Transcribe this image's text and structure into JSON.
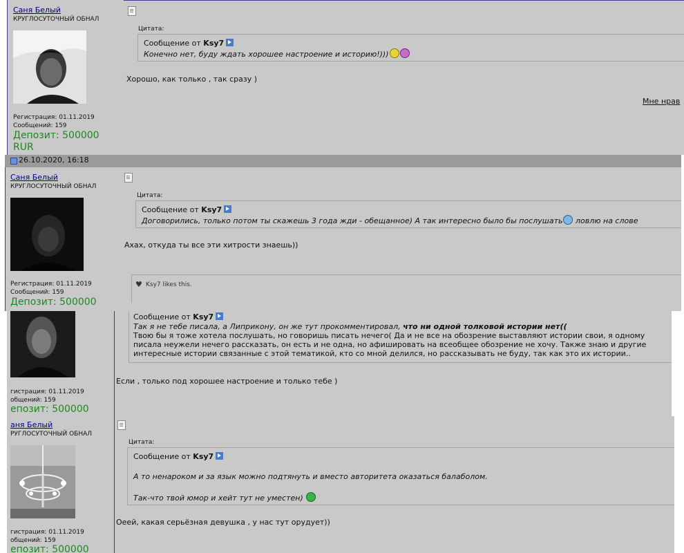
{
  "segments": [
    {
      "user": {
        "name": "Саня Белый",
        "title": "КРУГЛОСУТОЧНЫЙ ОБНАЛ",
        "reg": "Регистрация: 01.11.2019",
        "posts": "Сообщений: 159",
        "deposit_l1": "Депозит: 500000",
        "deposit_l2": "RUR"
      },
      "quote_label": "Цитата:",
      "quote_prefix": "Сообщение от",
      "quote_author": "Ksy7",
      "quote_text": "Конечно нет, буду ждать хорошее настроение и историю!)))",
      "body": "Хорошо, как только , так сразу )",
      "like_link": "Мне нрав"
    },
    {
      "datebar": "26.10.2020, 16:18",
      "user": {
        "name": "Саня Белый",
        "title": "КРУГЛОСУТОЧНЫЙ ОБНАЛ",
        "reg": "Регистрация: 01.11.2019",
        "posts": "Сообщений: 159",
        "deposit_l1": "Депозит: 500000"
      },
      "quote_label": "Цитата:",
      "quote_prefix": "Сообщение от",
      "quote_author": "Ksy7",
      "quote_text": "Договорились, только потом ты скажешь 3 года жди - обещанное) А так интересно было бы послушать",
      "quote_tail": "ловлю на слове",
      "body": "Ахах, откуда ты все эти хитрости знаешь))",
      "likes_user": "Ksy7",
      "likes_suffix": "likes this."
    },
    {
      "user": {
        "reg": "гистрация: 01.11.2019",
        "posts": "общений: 159",
        "deposit_l1": "епозит: 500000"
      },
      "quote_prefix": "Сообщение от",
      "quote_author": "Ksy7",
      "quote_l1": "Так я не тебе писала, а Липрикону, он же тут прокомментировал,",
      "quote_l1_bold": "что ни одной толковой истории нет((",
      "quote_l2": "Твою бы я тоже хотела послушать, но говоришь писать нечего( Да и не все на обозрение выставляют истории свои, я одному",
      "quote_l3": "писала неужели нечего рассказать, он есть и не одна, но афишировать на всеобщее обозрение не хочу. Также знаю и другие",
      "quote_l4": "интересные истории связанные с этой тематикой, кто со мной делился, но рассказывать не буду, так как это их истории..",
      "body": "Если , только под хорошее настроение и только тебе )"
    },
    {
      "user": {
        "name": "аня Белый",
        "title": "РУГЛОСУТОЧНЫЙ ОБНАЛ",
        "reg": "гистрация: 01.11.2019",
        "posts": "общений: 159",
        "deposit_l1": "епозит: 500000"
      },
      "quote_label": "Цитата:",
      "quote_prefix": "Сообщение от",
      "quote_author": "Ksy7",
      "quote_l1": "А то ненароком и за язык можно подтянуть и вместо авторитета оказаться балаболом.",
      "quote_l2": "Так-что твой юмор и хейт тут не уместен)",
      "body": "Оеей, какая серьёзная девушка , у нас тут орудует))"
    }
  ],
  "colors": {
    "bg": "#c9c9c9",
    "border": "#3b3f8c",
    "deposit": "#1c8a1c",
    "username": "#00007a"
  }
}
